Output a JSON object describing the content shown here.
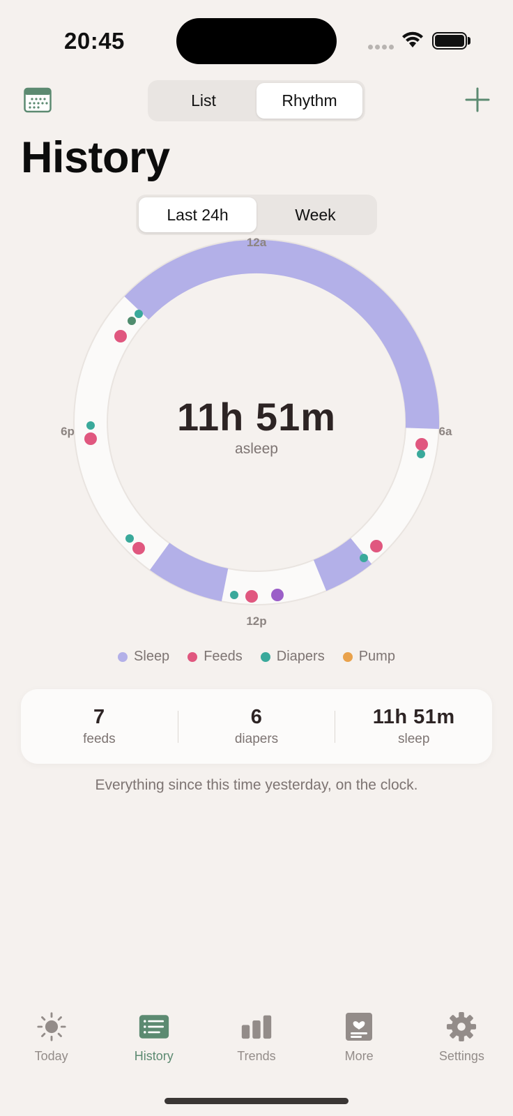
{
  "status_bar": {
    "time": "20:45"
  },
  "header": {
    "view_tabs": [
      {
        "label": "List",
        "active": false
      },
      {
        "label": "Rhythm",
        "active": true
      }
    ],
    "title": "History"
  },
  "range_tabs": [
    {
      "label": "Last 24h",
      "active": true
    },
    {
      "label": "Week",
      "active": false
    }
  ],
  "clock": {
    "hour_labels": {
      "top": "12a",
      "right": "6a",
      "bottom": "12p",
      "left": "6p"
    },
    "center_value": "11h 51m",
    "center_caption": "asleep"
  },
  "legend": [
    {
      "label": "Sleep",
      "color": "#b3b0e8"
    },
    {
      "label": "Feeds",
      "color": "#e0577f"
    },
    {
      "label": "Diapers",
      "color": "#3aa99b"
    },
    {
      "label": "Pump",
      "color": "#e9a24c"
    }
  ],
  "stats": [
    {
      "value": "7",
      "label": "feeds"
    },
    {
      "value": "6",
      "label": "diapers"
    },
    {
      "value": "11h 51m",
      "label": "sleep"
    }
  ],
  "footnote": "Everything since this time yesterday, on the clock.",
  "tab_bar": [
    {
      "label": "Today",
      "icon": "sun-icon",
      "active": false
    },
    {
      "label": "History",
      "icon": "list-icon",
      "active": true
    },
    {
      "label": "Trends",
      "icon": "bar-chart-icon",
      "active": false
    },
    {
      "label": "More",
      "icon": "journal-icon",
      "active": false
    },
    {
      "label": "Settings",
      "icon": "gear-icon",
      "active": false
    }
  ],
  "colors": {
    "accent": "#5c8a71",
    "sleep": "#b3b0e8",
    "feeds": "#e0577f",
    "diapers": "#3aa99b",
    "pump": "#e9a24c",
    "background": "#f5f1ee"
  }
}
